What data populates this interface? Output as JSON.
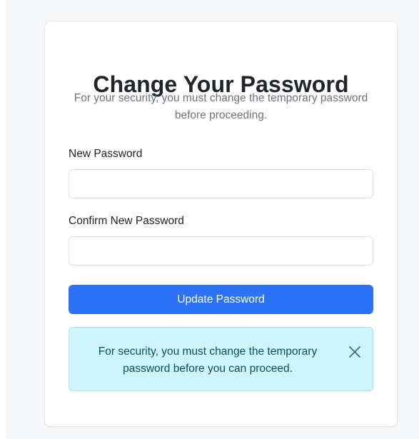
{
  "form": {
    "title": "Change Your Password",
    "subtitle": "For your security, you must change the temporary password before proceeding.",
    "new_password_label": "New Password",
    "new_password_value": "",
    "confirm_password_label": "Confirm New Password",
    "confirm_password_value": "",
    "submit_label": "Update Password"
  },
  "alert": {
    "message": "For security, you must change the temporary password before you can proceed.",
    "close_icon": "close-icon"
  },
  "colors": {
    "primary": "#2c72f6",
    "alert_bg": "#cff4fc",
    "alert_text": "#055160"
  }
}
